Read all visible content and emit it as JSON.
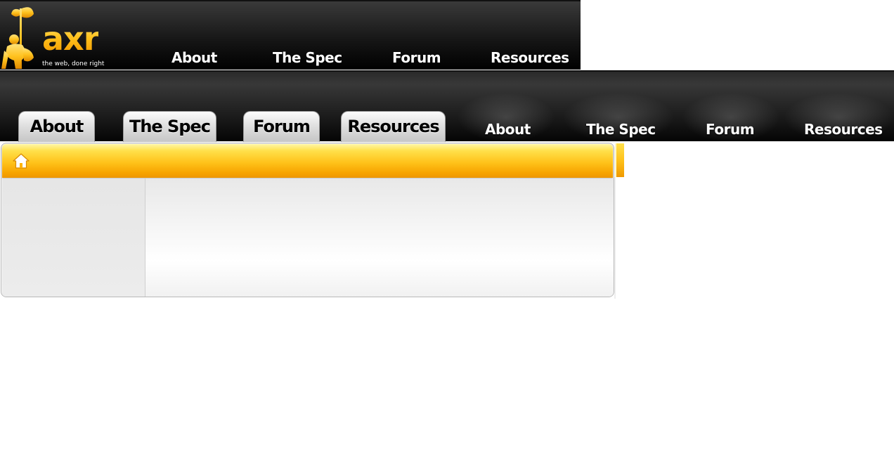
{
  "brand": {
    "name": "axr",
    "tagline": "the web, done right",
    "colors": {
      "gold": "#ffc21e",
      "dark": "#141414",
      "orange_bar": "#ffc21a"
    }
  },
  "header_nav": {
    "items": [
      {
        "label": "About"
      },
      {
        "label": "The Spec"
      },
      {
        "label": "Forum"
      },
      {
        "label": "Resources"
      }
    ]
  },
  "tab_nav": {
    "items": [
      {
        "label": "About"
      },
      {
        "label": "The Spec"
      },
      {
        "label": "Forum"
      },
      {
        "label": "Resources"
      }
    ]
  },
  "glow_nav": {
    "items": [
      {
        "label": "About"
      },
      {
        "label": "The Spec"
      },
      {
        "label": "Forum"
      },
      {
        "label": "Resources"
      }
    ]
  },
  "panel": {
    "home_icon": "home-icon"
  }
}
